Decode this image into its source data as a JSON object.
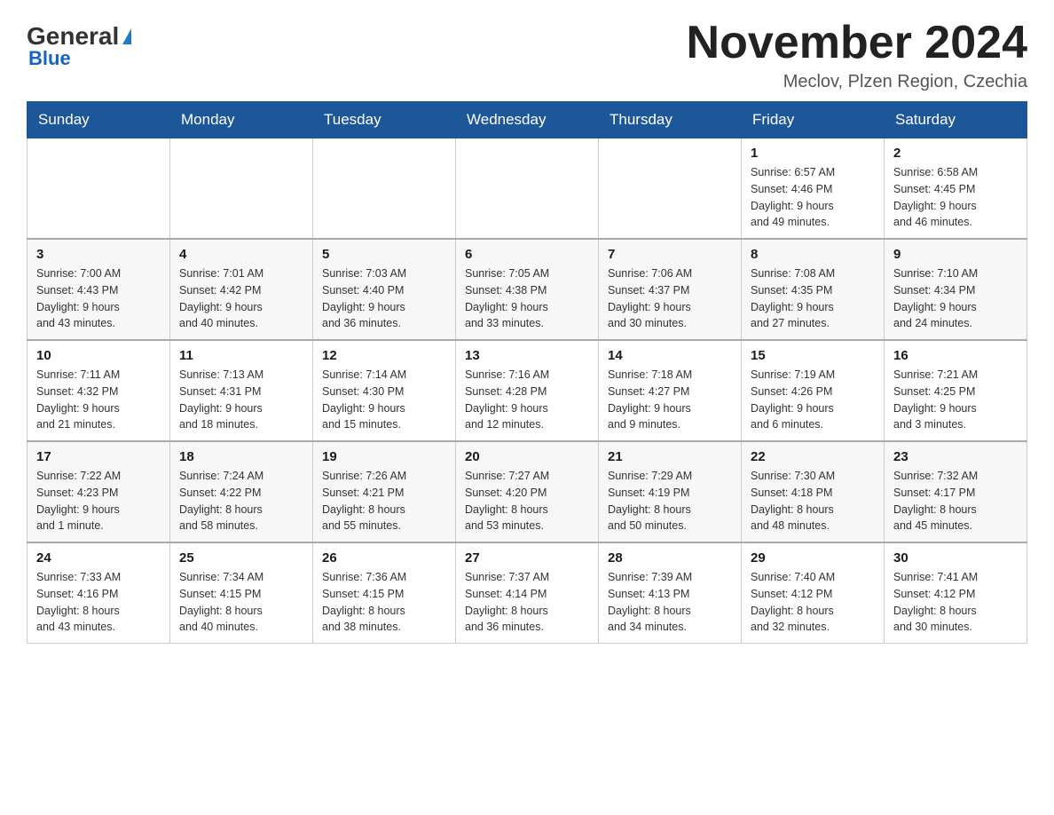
{
  "logo": {
    "general": "General",
    "triangle": "",
    "blue": "Blue"
  },
  "header": {
    "title": "November 2024",
    "location": "Meclov, Plzen Region, Czechia"
  },
  "weekdays": [
    "Sunday",
    "Monday",
    "Tuesday",
    "Wednesday",
    "Thursday",
    "Friday",
    "Saturday"
  ],
  "weeks": [
    {
      "days": [
        {
          "number": "",
          "info": ""
        },
        {
          "number": "",
          "info": ""
        },
        {
          "number": "",
          "info": ""
        },
        {
          "number": "",
          "info": ""
        },
        {
          "number": "",
          "info": ""
        },
        {
          "number": "1",
          "info": "Sunrise: 6:57 AM\nSunset: 4:46 PM\nDaylight: 9 hours\nand 49 minutes."
        },
        {
          "number": "2",
          "info": "Sunrise: 6:58 AM\nSunset: 4:45 PM\nDaylight: 9 hours\nand 46 minutes."
        }
      ]
    },
    {
      "days": [
        {
          "number": "3",
          "info": "Sunrise: 7:00 AM\nSunset: 4:43 PM\nDaylight: 9 hours\nand 43 minutes."
        },
        {
          "number": "4",
          "info": "Sunrise: 7:01 AM\nSunset: 4:42 PM\nDaylight: 9 hours\nand 40 minutes."
        },
        {
          "number": "5",
          "info": "Sunrise: 7:03 AM\nSunset: 4:40 PM\nDaylight: 9 hours\nand 36 minutes."
        },
        {
          "number": "6",
          "info": "Sunrise: 7:05 AM\nSunset: 4:38 PM\nDaylight: 9 hours\nand 33 minutes."
        },
        {
          "number": "7",
          "info": "Sunrise: 7:06 AM\nSunset: 4:37 PM\nDaylight: 9 hours\nand 30 minutes."
        },
        {
          "number": "8",
          "info": "Sunrise: 7:08 AM\nSunset: 4:35 PM\nDaylight: 9 hours\nand 27 minutes."
        },
        {
          "number": "9",
          "info": "Sunrise: 7:10 AM\nSunset: 4:34 PM\nDaylight: 9 hours\nand 24 minutes."
        }
      ]
    },
    {
      "days": [
        {
          "number": "10",
          "info": "Sunrise: 7:11 AM\nSunset: 4:32 PM\nDaylight: 9 hours\nand 21 minutes."
        },
        {
          "number": "11",
          "info": "Sunrise: 7:13 AM\nSunset: 4:31 PM\nDaylight: 9 hours\nand 18 minutes."
        },
        {
          "number": "12",
          "info": "Sunrise: 7:14 AM\nSunset: 4:30 PM\nDaylight: 9 hours\nand 15 minutes."
        },
        {
          "number": "13",
          "info": "Sunrise: 7:16 AM\nSunset: 4:28 PM\nDaylight: 9 hours\nand 12 minutes."
        },
        {
          "number": "14",
          "info": "Sunrise: 7:18 AM\nSunset: 4:27 PM\nDaylight: 9 hours\nand 9 minutes."
        },
        {
          "number": "15",
          "info": "Sunrise: 7:19 AM\nSunset: 4:26 PM\nDaylight: 9 hours\nand 6 minutes."
        },
        {
          "number": "16",
          "info": "Sunrise: 7:21 AM\nSunset: 4:25 PM\nDaylight: 9 hours\nand 3 minutes."
        }
      ]
    },
    {
      "days": [
        {
          "number": "17",
          "info": "Sunrise: 7:22 AM\nSunset: 4:23 PM\nDaylight: 9 hours\nand 1 minute."
        },
        {
          "number": "18",
          "info": "Sunrise: 7:24 AM\nSunset: 4:22 PM\nDaylight: 8 hours\nand 58 minutes."
        },
        {
          "number": "19",
          "info": "Sunrise: 7:26 AM\nSunset: 4:21 PM\nDaylight: 8 hours\nand 55 minutes."
        },
        {
          "number": "20",
          "info": "Sunrise: 7:27 AM\nSunset: 4:20 PM\nDaylight: 8 hours\nand 53 minutes."
        },
        {
          "number": "21",
          "info": "Sunrise: 7:29 AM\nSunset: 4:19 PM\nDaylight: 8 hours\nand 50 minutes."
        },
        {
          "number": "22",
          "info": "Sunrise: 7:30 AM\nSunset: 4:18 PM\nDaylight: 8 hours\nand 48 minutes."
        },
        {
          "number": "23",
          "info": "Sunrise: 7:32 AM\nSunset: 4:17 PM\nDaylight: 8 hours\nand 45 minutes."
        }
      ]
    },
    {
      "days": [
        {
          "number": "24",
          "info": "Sunrise: 7:33 AM\nSunset: 4:16 PM\nDaylight: 8 hours\nand 43 minutes."
        },
        {
          "number": "25",
          "info": "Sunrise: 7:34 AM\nSunset: 4:15 PM\nDaylight: 8 hours\nand 40 minutes."
        },
        {
          "number": "26",
          "info": "Sunrise: 7:36 AM\nSunset: 4:15 PM\nDaylight: 8 hours\nand 38 minutes."
        },
        {
          "number": "27",
          "info": "Sunrise: 7:37 AM\nSunset: 4:14 PM\nDaylight: 8 hours\nand 36 minutes."
        },
        {
          "number": "28",
          "info": "Sunrise: 7:39 AM\nSunset: 4:13 PM\nDaylight: 8 hours\nand 34 minutes."
        },
        {
          "number": "29",
          "info": "Sunrise: 7:40 AM\nSunset: 4:12 PM\nDaylight: 8 hours\nand 32 minutes."
        },
        {
          "number": "30",
          "info": "Sunrise: 7:41 AM\nSunset: 4:12 PM\nDaylight: 8 hours\nand 30 minutes."
        }
      ]
    }
  ]
}
